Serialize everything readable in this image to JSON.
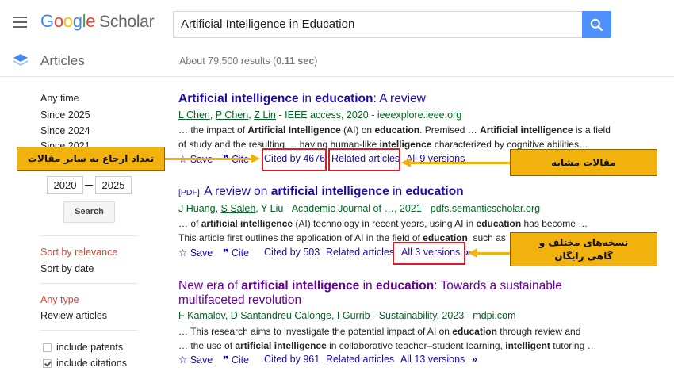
{
  "header": {
    "logo_google": [
      "G",
      "o",
      "o",
      "g",
      "l",
      "e"
    ],
    "logo_scholar": "Scholar",
    "search_query": "Artificial Intelligence in Education"
  },
  "subheader": {
    "section_title": "Articles",
    "results_prefix": "About 79,500 results (",
    "results_time": "0.11 sec",
    "results_suffix": ")"
  },
  "sidebar": {
    "time_filters": [
      "Any time",
      "Since 2025",
      "Since 2024",
      "Since 2021"
    ],
    "custom_from": "2020",
    "custom_to": "2025",
    "search_button": "Search",
    "sort_relevance": "Sort by relevance",
    "sort_date": "Sort by date",
    "type_any": "Any type",
    "type_review": "Review articles",
    "include_patents": "include patents",
    "include_citations": "include citations"
  },
  "results": [
    {
      "title_parts": [
        [
          "b",
          "Artificial intelligence"
        ],
        [
          "n",
          " in "
        ],
        [
          "b",
          "education"
        ],
        [
          "n",
          ": A review"
        ]
      ],
      "authors": [
        "L Chen",
        "P Chen",
        "Z Lin"
      ],
      "meta_rest": " - IEEE access, 2020 - ieeexplore.ieee.org",
      "snippet1": [
        [
          "n",
          "… the impact of "
        ],
        [
          "b",
          "Artificial Intelligence"
        ],
        [
          "n",
          " (AI) on "
        ],
        [
          "b",
          "education"
        ],
        [
          "n",
          ". Premised … "
        ],
        [
          "b",
          "Artificial intelligence"
        ],
        [
          "n",
          " is a field"
        ]
      ],
      "snippet2": [
        [
          "n",
          "of study and the resulting … having human-like "
        ],
        [
          "b",
          "intelligence"
        ],
        [
          "n",
          " characterized by cognitive abilities…"
        ]
      ],
      "save": "Save",
      "cite": "Cite",
      "cited_by": "Cited by 4676",
      "related": "Related articles",
      "versions": "All 9 versions"
    },
    {
      "pdf_tag": "[PDF]",
      "title_parts": [
        [
          "n",
          "A review on "
        ],
        [
          "b",
          "artificial intelligence"
        ],
        [
          "n",
          " in "
        ],
        [
          "b",
          "education"
        ]
      ],
      "authors": [
        "J Huang",
        "S Saleh",
        "Y Liu"
      ],
      "meta_rest": " - Academic Journal of …, 2021 - pdfs.semanticscholar.org",
      "snippet1": [
        [
          "n",
          "… of "
        ],
        [
          "b",
          "artificial intelligence"
        ],
        [
          "n",
          " (AI) technology in recent years, using AI in "
        ],
        [
          "b",
          "education"
        ],
        [
          "n",
          " has become …"
        ]
      ],
      "snippet2": [
        [
          "n",
          "This article first outlines the application of AI in the field of "
        ],
        [
          "b",
          "education"
        ],
        [
          "n",
          ", such as …"
        ]
      ],
      "save": "Save",
      "cite": "Cite",
      "cited_by": "Cited by 503",
      "related": "Related articles",
      "versions": "All 3 versions"
    },
    {
      "title_parts": [
        [
          "n",
          "New era of "
        ],
        [
          "b",
          "artificial intelligence"
        ],
        [
          "n",
          " in "
        ],
        [
          "b",
          "education"
        ],
        [
          "n",
          ": Towards a sustainable"
        ]
      ],
      "title_line2": "multifaceted revolution",
      "authors": [
        "F Kamalov",
        "D Santandreu Calonge",
        "I Gurrib"
      ],
      "meta_rest": " - Sustainability, 2023 - mdpi.com",
      "snippet1": [
        [
          "n",
          "… This research aims to investigate the potential impact of AI on "
        ],
        [
          "b",
          "education"
        ],
        [
          "n",
          " through review and"
        ]
      ],
      "snippet2": [
        [
          "n",
          "… the use of "
        ],
        [
          "b",
          "artificial intelligence"
        ],
        [
          "n",
          " in collaborative teacher–student learning, "
        ],
        [
          "b",
          "intelligent"
        ],
        [
          "n",
          " tutoring …"
        ]
      ],
      "save": "Save",
      "cite": "Cite",
      "cited_by": "Cited by 961",
      "related": "Related articles",
      "versions": "All 13 versions"
    }
  ],
  "annotations": {
    "cited_by_note": "تعداد ارجاع به سایر مقالات",
    "related_note": "مقالات مشابه",
    "versions_note_line1": "نسخه‌های مختلف و",
    "versions_note_line2": "گاهی رایگان"
  },
  "colors": {
    "link": "#1a0dab",
    "visited": "#660099",
    "green_meta": "#006621",
    "highlight_box": "#d21f26",
    "callout": "#f2b20d",
    "search_button": "#4d90fe"
  }
}
